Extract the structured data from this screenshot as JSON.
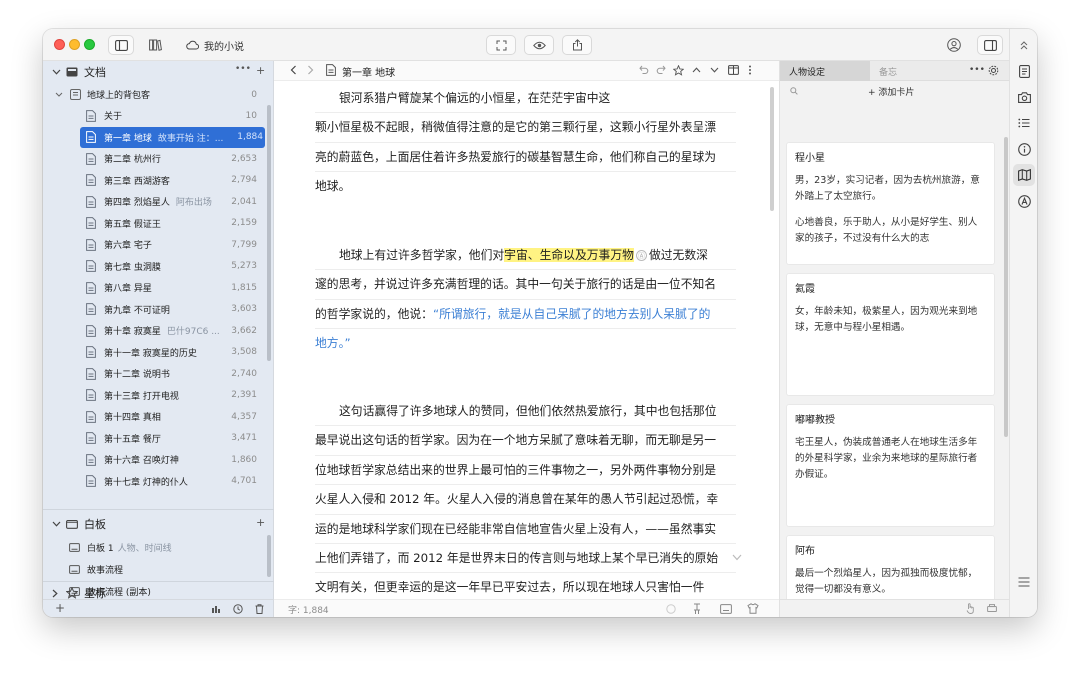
{
  "toolbar": {
    "project_name": "我的小说",
    "icons": [
      "sidebar-toggle-icon",
      "library-icon",
      "cloud-icon",
      "focus-icon",
      "preview-eye-icon",
      "share-icon",
      "account-icon",
      "panel-toggle-icon",
      "collapse-icon"
    ]
  },
  "sidebar": {
    "docs_section": {
      "label": "文档",
      "more": "•••",
      "add": "+"
    },
    "book": {
      "title": "地球上的背包客",
      "count": "0"
    },
    "chapters": [
      {
        "title": "关于",
        "note": "",
        "count": "10"
      },
      {
        "title": "第一章 地球",
        "note": "故事开始 注：...",
        "count": "1,884",
        "selected": true
      },
      {
        "title": "第二章 杭州行",
        "note": "",
        "count": "2,653"
      },
      {
        "title": "第三章 西湖游客",
        "note": "",
        "count": "2,794"
      },
      {
        "title": "第四章 烈焰星人",
        "note": "阿布出场",
        "count": "2,041"
      },
      {
        "title": "第五章 假证王",
        "note": "",
        "count": "2,159"
      },
      {
        "title": "第六章 宅子",
        "note": "",
        "count": "7,799"
      },
      {
        "title": "第七章 虫洞膜",
        "note": "",
        "count": "5,273"
      },
      {
        "title": "第八章 异星",
        "note": "",
        "count": "1,815"
      },
      {
        "title": "第九章 不可证明",
        "note": "",
        "count": "3,603"
      },
      {
        "title": "第十章 寂寞星",
        "note": "巴什97C6 ...",
        "count": "3,662"
      },
      {
        "title": "第十一章 寂寞星的历史",
        "note": "",
        "count": "3,508"
      },
      {
        "title": "第十二章 说明书",
        "note": "",
        "count": "2,740"
      },
      {
        "title": "第十三章 打开电视",
        "note": "",
        "count": "2,391"
      },
      {
        "title": "第十四章 真相",
        "note": "",
        "count": "4,357"
      },
      {
        "title": "第十五章 餐厅",
        "note": "",
        "count": "3,471"
      },
      {
        "title": "第十六章 召唤灯神",
        "note": "",
        "count": "1,860"
      },
      {
        "title": "第十七章 灯神的仆人",
        "note": "",
        "count": "4,701"
      }
    ],
    "whiteboard_section": {
      "label": "白板",
      "add": "+"
    },
    "whiteboards": [
      {
        "title": "白板 1",
        "note": "人物、时间线"
      },
      {
        "title": "故事流程",
        "note": ""
      },
      {
        "title": "故事流程 (副本)",
        "note": ""
      }
    ],
    "starred_section": {
      "label": "星标"
    },
    "bottom_add": "+"
  },
  "editor": {
    "title": "第一章 地球",
    "word_count": "字: 1,884",
    "paragraphs": [
      {
        "lines": [
          [
            {
              "t": "银河系猎户臂旋某个偏远的小恒星，在茫茫宇宙中这"
            }
          ],
          [
            {
              "t": "颗小恒星极不起眼，稍微值得注意的是它的第三颗行星，这颗小行星外表呈漂"
            }
          ],
          [
            {
              "t": "亮的蔚蓝色，上面居住着许多热爱旅行的碳基智慧生命，他们称自己的星球为"
            }
          ],
          [
            {
              "t": "地球。"
            }
          ]
        ]
      },
      {
        "lines": [
          [
            {
              "t": "地球上有过许多哲学家，他们对"
            },
            {
              "t": "宇宙、生命以及万事万物",
              "hl": true
            },
            {
              "t": "Ⓐ",
              "mark": true
            },
            {
              "t": "做过无数深"
            }
          ],
          [
            {
              "t": "邃的思考，并说过许多充满哲理的话。其中一句关于旅行的话是由一位不知名"
            }
          ],
          [
            {
              "t": "的哲学家说的，他说："
            },
            {
              "t": "“所谓旅行，就是从自己呆腻了的地方去别人呆腻了的",
              "q": true
            }
          ],
          [
            {
              "t": "地方。”",
              "q": true
            }
          ]
        ]
      },
      {
        "lines": [
          [
            {
              "t": "这句话赢得了许多地球人的赞同，但他们依然热爱旅行，其中也包括那位"
            }
          ],
          [
            {
              "t": "最早说出这句话的哲学家。因为在一个地方呆腻了意味着无聊，而无聊是另一"
            }
          ],
          [
            {
              "t": "位地球哲学家总结出来的世界上最可怕的三件事物之一，另外两件事物分别是"
            }
          ],
          [
            {
              "t": "火星人入侵和 2012 年。火星人入侵的消息曾在某年的愚人节引起过恐慌，幸"
            }
          ],
          [
            {
              "t": "运的是地球科学家们现在已经能非常自信地宣告火星上没有人，——虽然事实"
            }
          ],
          [
            {
              "t": "上他们弄错了，而 2012 年是世界末日的传言则与地球上某个早已消失的原始"
            }
          ],
          [
            {
              "t": "文明有关，但更幸运的是这一年早已平安过去，所以现在地球人只害怕一件"
            }
          ]
        ]
      }
    ]
  },
  "right_panel": {
    "tab_active": "人物设定",
    "tab_inactive": "备忘",
    "more": "•••",
    "add_card": "+ 添加卡片",
    "cards": [
      {
        "name": "程小星",
        "paras": [
          "男，23岁，实习记者，因为去杭州旅游，意外踏上了太空旅行。",
          "心地善良，乐于助人，从小是好学生、别人家的孩子，不过没有什么大的志"
        ]
      },
      {
        "name": "氦霞",
        "paras": [
          "女，年龄未知，极紫星人，因为观光来到地球，无意中与程小星相遇。"
        ]
      },
      {
        "name": "嘟嘟教授",
        "paras": [
          "宅王星人，伪装成普通老人在地球生活多年的外星科学家，业余为来地球的星际旅行者办假证。"
        ]
      },
      {
        "name": "阿布",
        "paras": [
          "最后一个烈焰星人，因为孤独而极度忧郁，觉得一切都没有意义。"
        ]
      }
    ]
  },
  "rail": {
    "icons": [
      "document-icon",
      "camera-icon",
      "outline-list-icon",
      "info-icon",
      "map-icon",
      "annotation-icon",
      "menu-icon"
    ]
  },
  "colors": {
    "selection": "#2f6fd6",
    "highlight": "#fff383",
    "quote": "#3b7fd4",
    "sidebar_bg": "#e3e9f2"
  }
}
